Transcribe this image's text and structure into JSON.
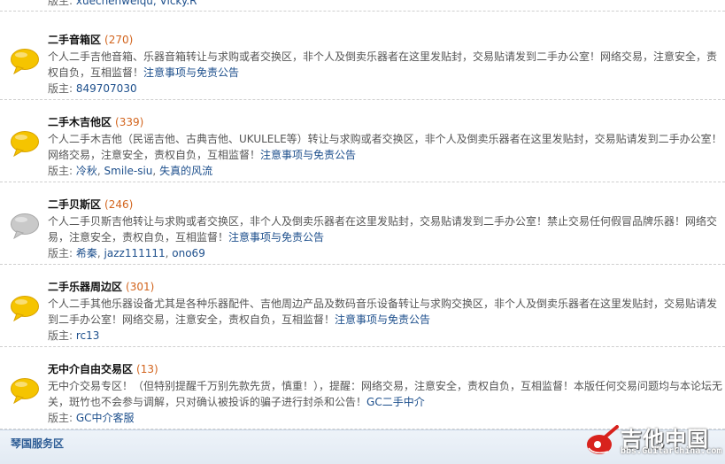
{
  "top_partial": {
    "mods_label": "版主:",
    "mods_text": "xuechenweiqu, Vicky.R"
  },
  "forums": [
    {
      "name": "二手音箱区",
      "count": "(270)",
      "icon": "yellow-bubble-icon",
      "desc": "个人二手吉他音箱、乐器音箱转让与求购或者交换区，非个人及倒卖乐器者在这里发贴封，交易贴请发到二手办公室！网络交易，注意安全，责权自负，互相监督！",
      "link": "注意事项与免责公告",
      "mods_label": "版主:",
      "mods": [
        "849707030"
      ]
    },
    {
      "name": "二手木吉他区",
      "count": "(339)",
      "icon": "yellow-bubble-icon",
      "desc": "个人二手木吉他（民谣吉他、古典吉他、UKULELE等）转让与求购或者交换区，非个人及倒卖乐器者在这里发贴封，交易贴请发到二手办公室！网络交易，注意安全，责权自负，互相监督！",
      "link": "注意事项与免责公告",
      "mods_label": "版主:",
      "mods": [
        "冷秋",
        "Smile-siu",
        "失真的风流"
      ]
    },
    {
      "name": "二手贝斯区",
      "count": "(246)",
      "icon": "gray-bubble-icon",
      "desc": "个人二手贝斯吉他转让与求购或者交换区，非个人及倒卖乐器者在这里发贴封，交易贴请发到二手办公室！禁止交易任何假冒品牌乐器！网络交易，注意安全，责权自负，互相监督！",
      "link": "注意事项与免责公告",
      "mods_label": "版主:",
      "mods": [
        "希秦",
        "jazz111111",
        "ono69"
      ]
    },
    {
      "name": "二手乐器周边区",
      "count": "(301)",
      "icon": "yellow-bubble-icon",
      "desc": "个人二手其他乐器设备尤其是各种乐器配件、吉他周边产品及数码音乐设备转让与求购交换区，非个人及倒卖乐器者在这里发贴封，交易贴请发到二手办公室！网络交易，注意安全，责权自负，互相监督！",
      "link": "注意事项与免责公告",
      "mods_label": "版主:",
      "mods": [
        "rc13"
      ]
    },
    {
      "name": "无中介自由交易区",
      "count": "(13)",
      "icon": "yellow-bubble-icon",
      "desc": "无中介交易专区！（但特别提醒千万别先款先货，慎重！），提醒：网络交易，注意安全，责权自负，互相监督！本版任何交易问题均与本论坛无关，斑竹也不会参与调解，只对确认被投诉的骗子进行封杀和公告！",
      "link": "GC二手中介",
      "mods_label": "版主:",
      "mods": [
        "GC中介客服"
      ]
    }
  ],
  "section": {
    "title": "琴国服务区"
  },
  "watermark": {
    "text": "吉他中国",
    "url": "bbs.GuitarChina.com"
  },
  "colors": {
    "accent": "#1d4f8c",
    "count": "#d2641d",
    "bubble_yellow": "#f5c400",
    "bubble_gray": "#c9c9c9"
  }
}
